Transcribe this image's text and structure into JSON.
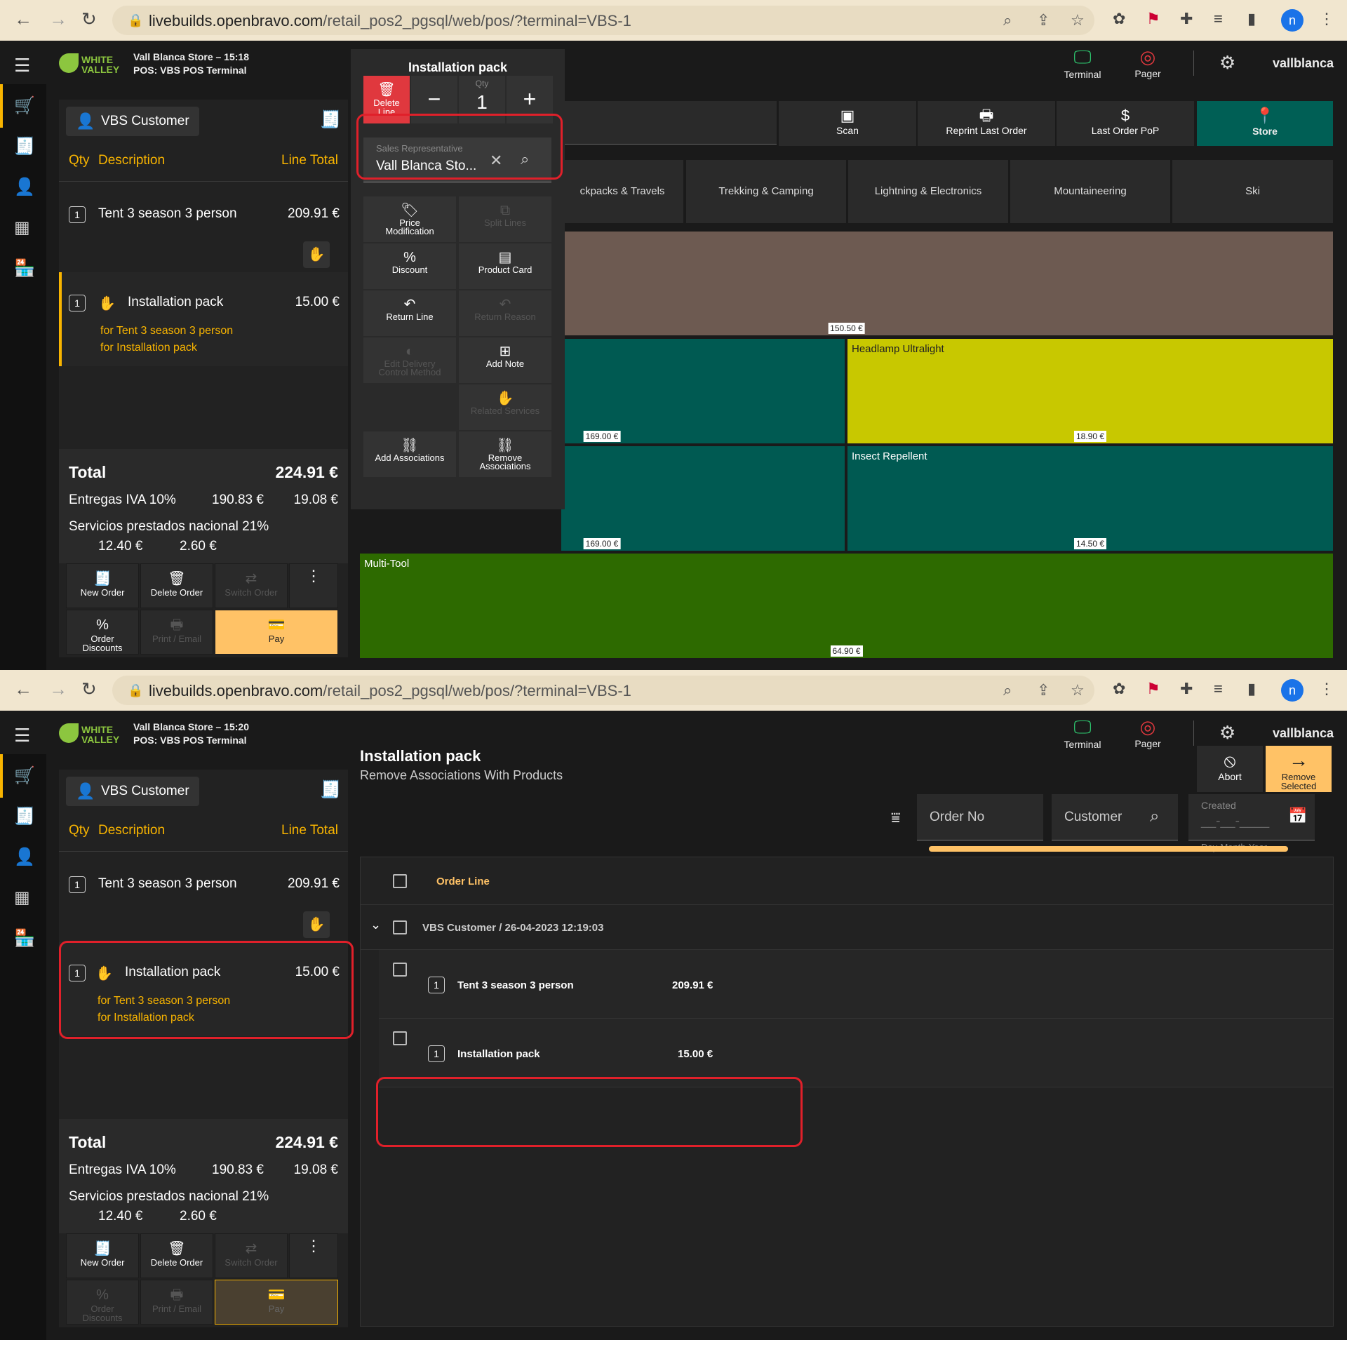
{
  "browser": {
    "url_host": "livebuilds.openbravo.com",
    "url_path": "/retail_pos2_pgsql/web/pos/?terminal=VBS-1",
    "profile_initial": "n"
  },
  "app": {
    "logo_line1": "WHITE",
    "logo_line2": "VALLEY",
    "terminal_label": "Terminal",
    "pager_label": "Pager",
    "username": "vallblanca",
    "pos_line": "POS: VBS POS Terminal"
  },
  "screen1": {
    "store_time": "Vall Blanca Store – 15:18"
  },
  "screen2": {
    "store_time": "Vall Blanca Store – 15:20"
  },
  "order": {
    "customer": "VBS Customer",
    "col_qty": "Qty",
    "col_desc": "Description",
    "col_total": "Line Total",
    "lines": [
      {
        "qty": "1",
        "desc": "Tent 3 season 3 person",
        "total": "209.91 €"
      },
      {
        "qty": "1",
        "desc": "Installation pack",
        "total": "15.00 €",
        "sub1": "for Tent 3 season 3 person",
        "sub2": "for Installation pack"
      }
    ],
    "total_label": "Total",
    "total_value": "224.91 €",
    "tax1_label": "Entregas IVA 10%",
    "tax1_base": "190.83 €",
    "tax1_amt": "19.08 €",
    "tax2_label": "Servicios prestados nacional 21%",
    "tax2_base": "12.40 €",
    "tax2_amt": "2.60 €"
  },
  "order_buttons": {
    "new_order": "New Order",
    "delete_order": "Delete Order",
    "switch_order": "Switch Order",
    "order_discounts_1": "Order",
    "order_discounts_2": "Discounts",
    "print_email": "Print / Email",
    "pay": "Pay"
  },
  "popup": {
    "title": "Installation pack",
    "delete_1": "Delete",
    "delete_2": "Line",
    "qty_label": "Qty",
    "qty_value": "1",
    "sales_rep_label": "Sales Representative",
    "sales_rep_value": "Vall Blanca Sto...",
    "actions": {
      "price_mod_1": "Price",
      "price_mod_2": "Modification",
      "split_lines": "Split Lines",
      "discount": "Discount",
      "product_card": "Product Card",
      "return_line": "Return Line",
      "return_reason": "Return Reason",
      "edit_delivery_1": "Edit Delivery",
      "edit_delivery_2": "Control Method",
      "add_note": "Add Note",
      "related_services": "Related Services",
      "add_associations": "Add Associations",
      "remove_assoc_1": "Remove",
      "remove_assoc_2": "Associations"
    }
  },
  "toolbar1": {
    "scan": "Scan",
    "reprint": "Reprint Last Order",
    "last_pop": "Last Order PoP",
    "store": "Store"
  },
  "categories": [
    "ckpacks & Travels",
    "Trekking & Camping",
    "Lightning & Electronics",
    "Mountaineering",
    "Ski"
  ],
  "products": [
    {
      "name": "",
      "price": "150.50 €",
      "color": "#6d5a51"
    },
    {
      "name": "",
      "price": "169.00 €",
      "color": "#005a52"
    },
    {
      "name": "Headlamp Ultralight",
      "price": "18.90 €",
      "color": "#c8c800"
    },
    {
      "name": "",
      "price": "169.00 €",
      "color": "#005a52"
    },
    {
      "name": "Insect Repellent",
      "price": "14.50 €",
      "color": "#005a52"
    },
    {
      "name": "Multi-Tool",
      "price": "64.90 €",
      "color": "#2d6a00"
    }
  ],
  "remove_assoc": {
    "title": "Installation pack",
    "subtitle": "Remove Associations With Products",
    "abort": "Abort",
    "remove_1": "Remove",
    "remove_2": "Selected",
    "order_no": "Order No",
    "customer": "Customer",
    "created": "Created",
    "date_placeholder": "__-__-____",
    "date_hint": "Day-Month-Year",
    "col_order_line": "Order Line",
    "group": "VBS Customer /  26-04-2023 12:19:03",
    "rows": [
      {
        "qty": "1",
        "name": "Tent 3 season 3 person",
        "price": "209.91 €"
      },
      {
        "qty": "1",
        "name": "Installation pack",
        "price": "15.00 €"
      }
    ]
  }
}
